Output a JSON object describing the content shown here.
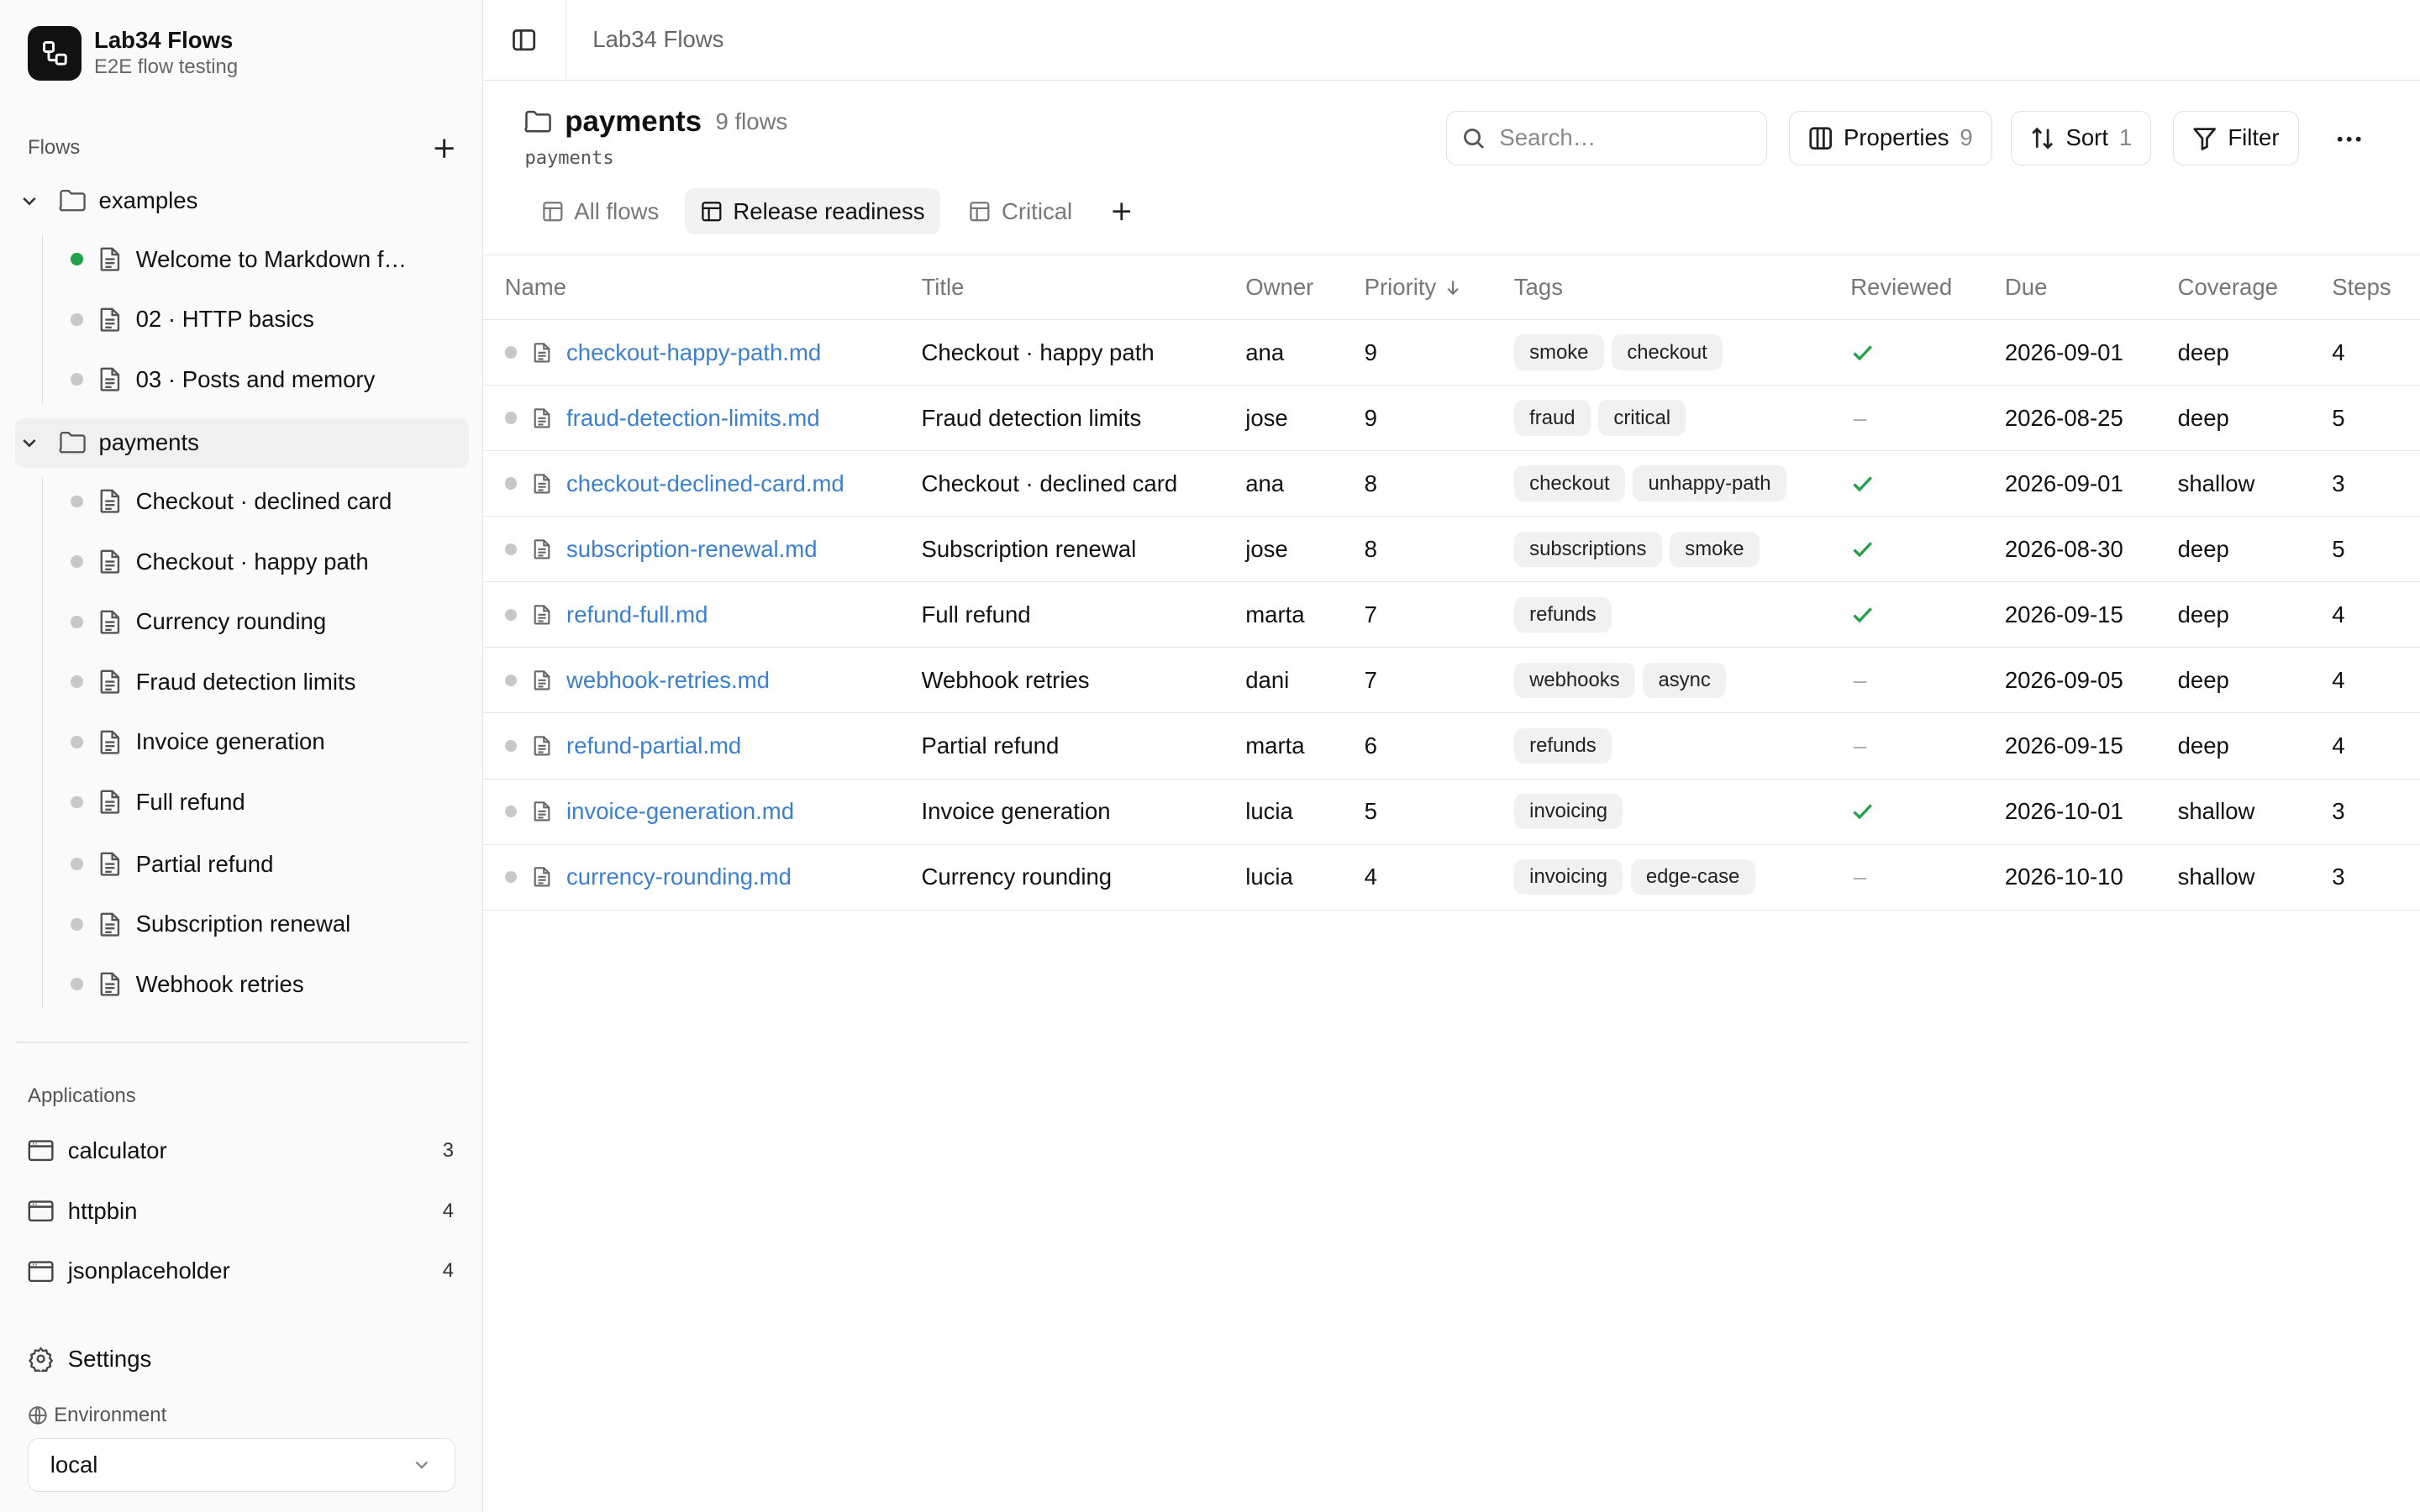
{
  "brand": {
    "name": "Lab34 Flows",
    "subtitle": "E2E flow testing"
  },
  "sidebar": {
    "flows_heading": "Flows",
    "folders": [
      {
        "name": "examples",
        "files": [
          {
            "name": "Welcome to Markdown f…",
            "status": "green"
          },
          {
            "name": "02 · HTTP basics",
            "status": "grey"
          },
          {
            "name": "03 · Posts and memory",
            "status": "grey"
          }
        ]
      },
      {
        "name": "payments",
        "selected": true,
        "files": [
          {
            "name": "Checkout · declined card",
            "status": "grey"
          },
          {
            "name": "Checkout · happy path",
            "status": "grey"
          },
          {
            "name": "Currency rounding",
            "status": "grey"
          },
          {
            "name": "Fraud detection limits",
            "status": "grey"
          },
          {
            "name": "Invoice generation",
            "status": "grey"
          },
          {
            "name": "Full refund",
            "status": "grey"
          },
          {
            "name": "Partial refund",
            "status": "grey"
          },
          {
            "name": "Subscription renewal",
            "status": "grey"
          },
          {
            "name": "Webhook retries",
            "status": "grey"
          }
        ]
      }
    ],
    "applications_heading": "Applications",
    "applications": [
      {
        "name": "calculator",
        "count": "3"
      },
      {
        "name": "httpbin",
        "count": "4"
      },
      {
        "name": "jsonplaceholder",
        "count": "4"
      }
    ],
    "settings_label": "Settings",
    "environment_label": "Environment",
    "environment_value": "local"
  },
  "topbar": {
    "breadcrumb": "Lab34 Flows"
  },
  "page": {
    "title": "payments",
    "count": "9 flows",
    "path": "payments"
  },
  "toolbar": {
    "search_placeholder": "Search…",
    "properties_label": "Properties",
    "properties_count": "9",
    "sort_label": "Sort",
    "sort_count": "1",
    "filter_label": "Filter"
  },
  "tabs": [
    {
      "label": "All flows",
      "active": false
    },
    {
      "label": "Release readiness",
      "active": true
    },
    {
      "label": "Critical",
      "active": false
    }
  ],
  "table": {
    "columns": {
      "name": "Name",
      "title": "Title",
      "owner": "Owner",
      "priority": "Priority",
      "tags": "Tags",
      "reviewed": "Reviewed",
      "due": "Due",
      "coverage": "Coverage",
      "steps": "Steps"
    },
    "rows": [
      {
        "file": "checkout-happy-path.md",
        "title": "Checkout · happy path",
        "owner": "ana",
        "priority": "9",
        "tags": [
          "smoke",
          "checkout"
        ],
        "reviewed": true,
        "due": "2026-09-01",
        "coverage": "deep",
        "steps": "4"
      },
      {
        "file": "fraud-detection-limits.md",
        "title": "Fraud detection limits",
        "owner": "jose",
        "priority": "9",
        "tags": [
          "fraud",
          "critical"
        ],
        "reviewed": false,
        "due": "2026-08-25",
        "coverage": "deep",
        "steps": "5"
      },
      {
        "file": "checkout-declined-card.md",
        "title": "Checkout · declined card",
        "owner": "ana",
        "priority": "8",
        "tags": [
          "checkout",
          "unhappy-path"
        ],
        "reviewed": true,
        "due": "2026-09-01",
        "coverage": "shallow",
        "steps": "3"
      },
      {
        "file": "subscription-renewal.md",
        "title": "Subscription renewal",
        "owner": "jose",
        "priority": "8",
        "tags": [
          "subscriptions",
          "smoke"
        ],
        "reviewed": true,
        "due": "2026-08-30",
        "coverage": "deep",
        "steps": "5"
      },
      {
        "file": "refund-full.md",
        "title": "Full refund",
        "owner": "marta",
        "priority": "7",
        "tags": [
          "refunds"
        ],
        "reviewed": true,
        "due": "2026-09-15",
        "coverage": "deep",
        "steps": "4"
      },
      {
        "file": "webhook-retries.md",
        "title": "Webhook retries",
        "owner": "dani",
        "priority": "7",
        "tags": [
          "webhooks",
          "async"
        ],
        "reviewed": false,
        "due": "2026-09-05",
        "coverage": "deep",
        "steps": "4"
      },
      {
        "file": "refund-partial.md",
        "title": "Partial refund",
        "owner": "marta",
        "priority": "6",
        "tags": [
          "refunds"
        ],
        "reviewed": false,
        "due": "2026-09-15",
        "coverage": "deep",
        "steps": "4"
      },
      {
        "file": "invoice-generation.md",
        "title": "Invoice generation",
        "owner": "lucia",
        "priority": "5",
        "tags": [
          "invoicing"
        ],
        "reviewed": true,
        "due": "2026-10-01",
        "coverage": "shallow",
        "steps": "3"
      },
      {
        "file": "currency-rounding.md",
        "title": "Currency rounding",
        "owner": "lucia",
        "priority": "4",
        "tags": [
          "invoicing",
          "edge-case"
        ],
        "reviewed": false,
        "due": "2026-10-10",
        "coverage": "shallow",
        "steps": "3"
      }
    ]
  },
  "colors": {
    "link": "#3b7fd1",
    "success": "#22a04a",
    "dot_active": "#22a04a",
    "dot_idle": "#c8c8c8"
  },
  "icons": {
    "brand": "flow-logo-icon",
    "folder": "folder-icon",
    "file": "file-icon",
    "chevron": "chevron-down-icon",
    "add": "plus-icon",
    "app": "app-window-icon",
    "settings": "gear-icon",
    "globe": "globe-icon",
    "sidebar_toggle": "sidebar-toggle-icon",
    "search": "search-icon",
    "columns": "columns-icon",
    "sort": "sort-icon",
    "filter": "filter-icon",
    "more": "more-horizontal-icon",
    "table": "table-icon",
    "check": "check-icon",
    "arrow_down": "arrow-down-icon"
  }
}
